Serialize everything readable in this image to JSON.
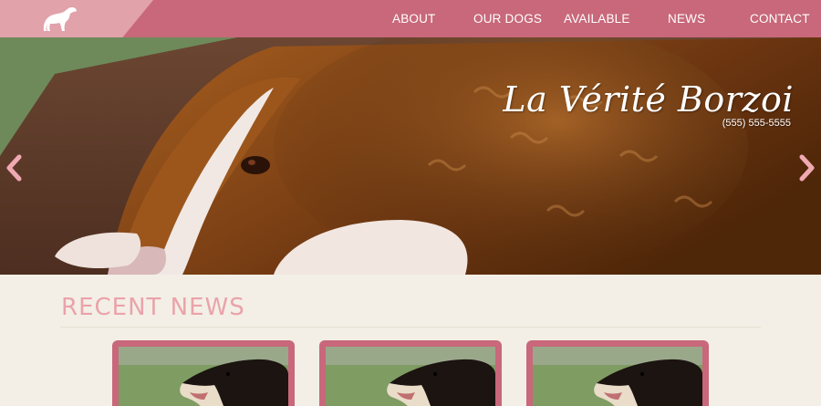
{
  "nav": {
    "items": [
      {
        "label": "ABOUT"
      },
      {
        "label": "OUR DOGS"
      },
      {
        "label": "AVAILABLE"
      },
      {
        "label": "NEWS"
      },
      {
        "label": "CONTACT"
      }
    ]
  },
  "hero": {
    "title": "La Vérité Borzoi",
    "phone": "(555) 555-5555"
  },
  "news": {
    "heading": "RECENT NEWS",
    "cards": [
      {
        "image": "borzoi-head-photo"
      },
      {
        "image": "borzoi-head-photo"
      },
      {
        "image": "borzoi-head-photo"
      }
    ]
  },
  "colors": {
    "header": "#c8687a",
    "logo_wedge": "#e1a2aa",
    "page_bg": "#f3efe6",
    "heading_pink": "#eaa3aa",
    "arrow_pink": "#f0a9b2"
  },
  "icons": [
    "borzoi-logo-icon",
    "chevron-left-icon",
    "chevron-right-icon"
  ]
}
